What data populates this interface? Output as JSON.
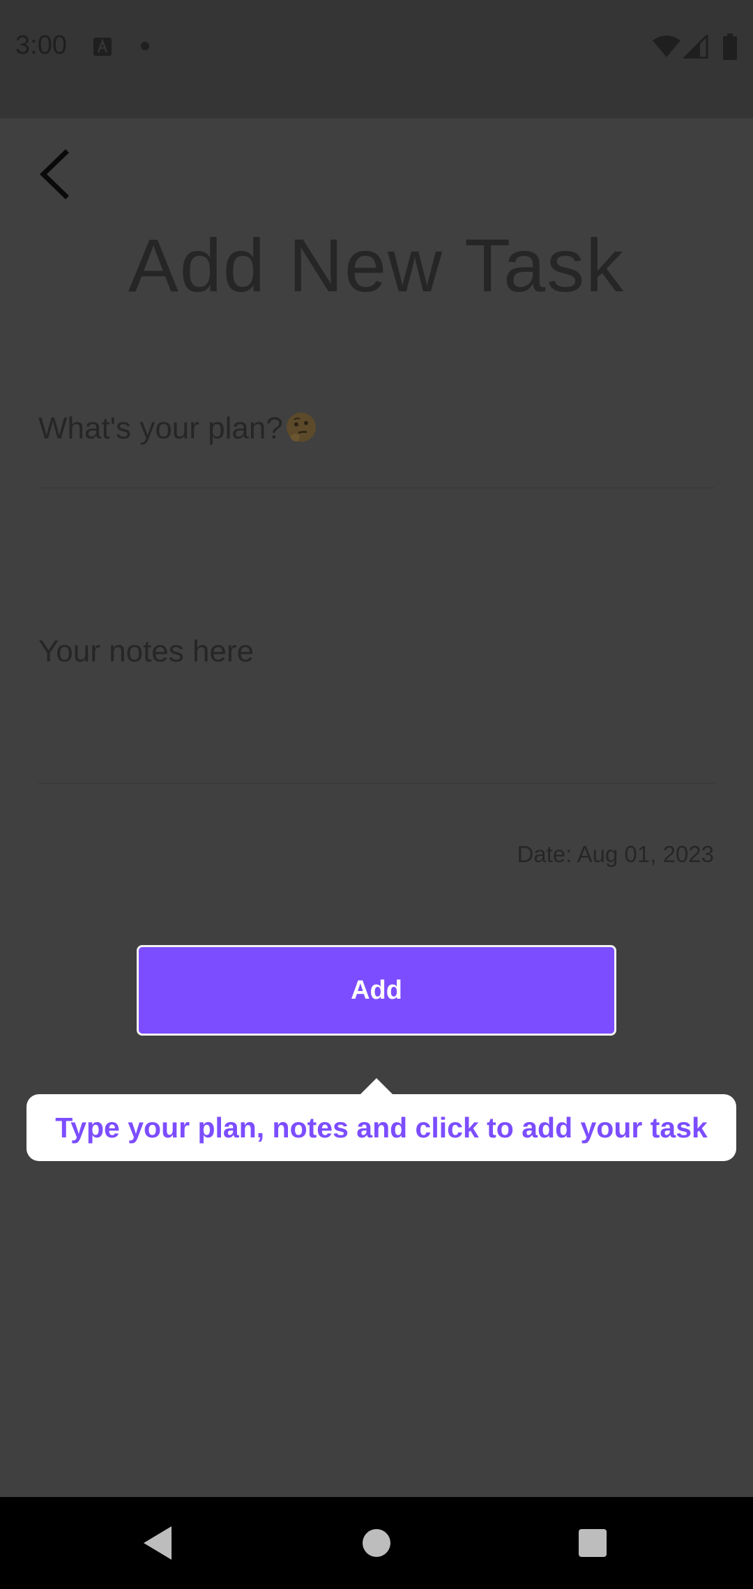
{
  "status_bar": {
    "time": "3:00",
    "icons": [
      "text-a-icon",
      "notification-dot-icon",
      "wifi-icon",
      "signal-icon",
      "battery-icon"
    ]
  },
  "header": {
    "back_icon": "chevron-left-icon",
    "title": "Add New Task"
  },
  "form": {
    "plan_placeholder": "What's your plan?",
    "plan_emoji_icon": "thinking-face-icon",
    "notes_placeholder": "Your notes here",
    "date_label": "Date: Aug 01, 2023"
  },
  "add_button": {
    "label": "Add",
    "color": "#7c4dff"
  },
  "tooltip": {
    "text": "Type your plan, notes and click to add your task"
  },
  "nav_bar": {
    "icons": [
      "nav-back-icon",
      "nav-home-icon",
      "nav-recents-icon"
    ]
  },
  "colors": {
    "overlay": "#404040",
    "accent": "#7c4dff",
    "tooltip_bg": "#ffffff"
  }
}
